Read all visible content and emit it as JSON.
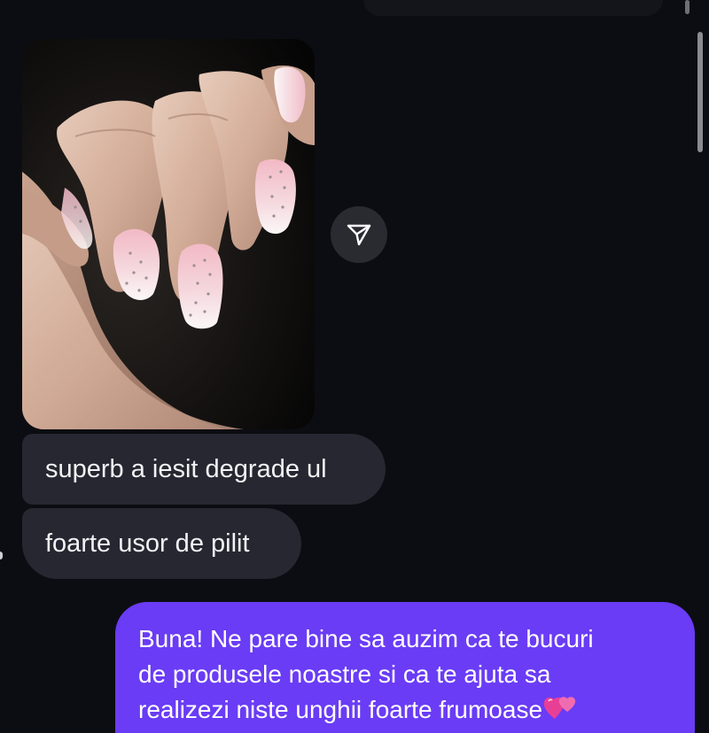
{
  "thread": {
    "incoming": [
      {
        "type": "image",
        "alt": ""
      },
      {
        "type": "text",
        "text": "superb a iesit degrade ul"
      },
      {
        "type": "text",
        "text": "foarte usor de pilit"
      }
    ],
    "outgoing": {
      "lines": [
        "Buna! Ne pare bine sa auzim ca te bucuri",
        "de produsele noastre si ca te ajuta sa",
        "realizezi niste unghii foarte frumoase"
      ],
      "emoji": "two-hearts"
    }
  },
  "icons": {
    "share": "paper-plane-icon",
    "heart": "two-hearts-icon"
  },
  "colors": {
    "background": "#0c0d12",
    "incoming_bubble": "#262730",
    "outgoing_bubble": "#6a3cf5",
    "share_button": "#2a2b31",
    "text": "#f2f2f5"
  }
}
